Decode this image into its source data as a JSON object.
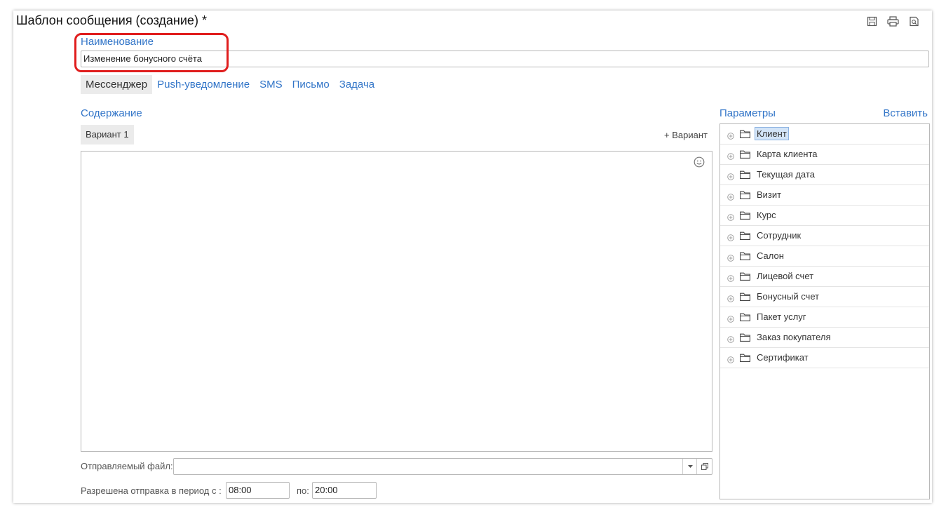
{
  "window": {
    "title": "Шаблон сообщения (создание) *"
  },
  "toolbar_icons": [
    "save-icon",
    "print-icon",
    "preview-icon"
  ],
  "name_field": {
    "label": "Наименование",
    "value": "Изменение бонусного счёта"
  },
  "tabs": [
    {
      "label": "Мессенджер",
      "active": true
    },
    {
      "label": "Push-уведомление",
      "active": false
    },
    {
      "label": "SMS",
      "active": false
    },
    {
      "label": "Письмо",
      "active": false
    },
    {
      "label": "Задача",
      "active": false
    }
  ],
  "content": {
    "label": "Содержание",
    "variant_tab": "Вариант 1",
    "add_variant": "+ Вариант",
    "text": ""
  },
  "file_field": {
    "label": "Отправляемый файл:",
    "value": ""
  },
  "period": {
    "label": "Разрешена отправка в период с :",
    "from": "08:00",
    "to_label": "по:",
    "to": "20:00"
  },
  "parameters": {
    "label": "Параметры",
    "insert_label": "Вставить",
    "items": [
      {
        "label": "Клиент",
        "selected": true
      },
      {
        "label": "Карта клиента",
        "selected": false
      },
      {
        "label": "Текущая дата",
        "selected": false
      },
      {
        "label": "Визит",
        "selected": false
      },
      {
        "label": "Курс",
        "selected": false
      },
      {
        "label": "Сотрудник",
        "selected": false
      },
      {
        "label": "Салон",
        "selected": false
      },
      {
        "label": "Лицевой счет",
        "selected": false
      },
      {
        "label": "Бонусный счет",
        "selected": false
      },
      {
        "label": "Пакет услуг",
        "selected": false
      },
      {
        "label": "Заказ покупателя",
        "selected": false
      },
      {
        "label": "Сертификат",
        "selected": false
      }
    ]
  },
  "colors": {
    "link": "#3275c8",
    "highlight": "#e01e1e",
    "selected_bg": "#d3e4f7"
  }
}
